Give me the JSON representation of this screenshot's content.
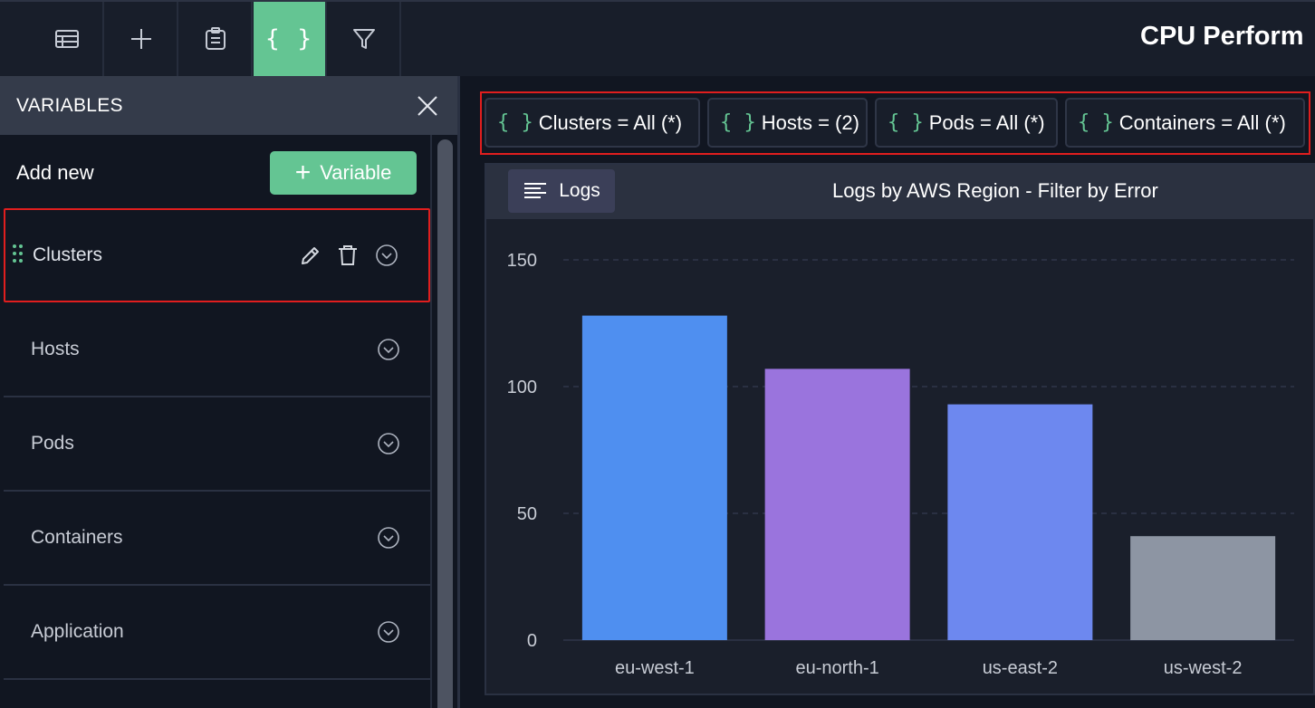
{
  "toolbar": {
    "buttons": [
      {
        "name": "table-icon"
      },
      {
        "name": "plus-icon"
      },
      {
        "name": "clipboard-icon"
      },
      {
        "name": "braces-icon",
        "label": "{ }",
        "active": true
      },
      {
        "name": "filter-icon"
      }
    ],
    "title": "CPU Perform"
  },
  "variables_panel": {
    "title": "VARIABLES",
    "add_new_label": "Add new",
    "add_button_label": "Variable",
    "items": [
      {
        "label": "Clusters",
        "selected": true
      },
      {
        "label": "Hosts"
      },
      {
        "label": "Pods"
      },
      {
        "label": "Containers"
      },
      {
        "label": "Application"
      }
    ]
  },
  "filter_chips": [
    {
      "braces": "{ }",
      "label": "Clusters = All (*)"
    },
    {
      "braces": "{ }",
      "label": "Hosts = (2)"
    },
    {
      "braces": "{ }",
      "label": "Pods = All (*)"
    },
    {
      "braces": "{ }",
      "label": "Containers = All (*)"
    }
  ],
  "panel_card": {
    "logs_button_label": "Logs",
    "title": "Logs by AWS Region - Filter by Error"
  },
  "colors": {
    "accent": "#64c593",
    "selection_outline": "#e01e1e"
  },
  "chart_data": {
    "type": "bar",
    "categories": [
      "eu-west-1",
      "eu-north-1",
      "us-east-2",
      "us-west-2"
    ],
    "values": [
      128,
      107,
      93,
      41
    ],
    "bar_colors": [
      "#4f8ff0",
      "#9a74dd",
      "#6d88ef",
      "#8d95a3"
    ],
    "yticks": [
      0,
      50,
      100,
      150
    ],
    "ylim": [
      0,
      150
    ],
    "grid": true,
    "title": "",
    "xlabel": "",
    "ylabel": ""
  }
}
